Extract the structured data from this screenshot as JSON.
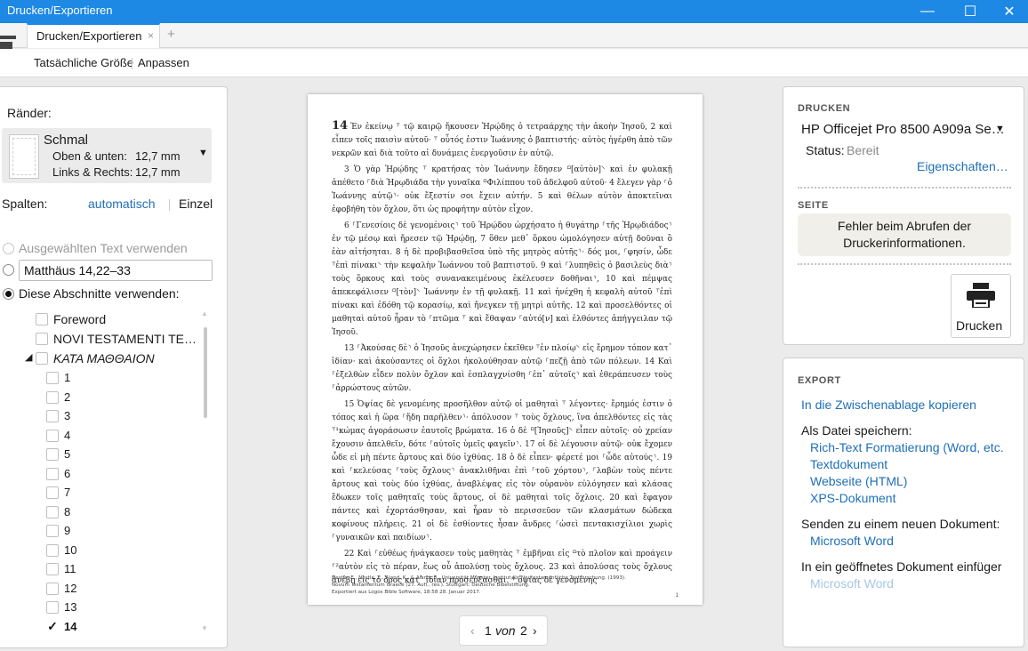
{
  "window": {
    "title": "Drucken/Exportieren",
    "minimize": "—",
    "maximize": "☐",
    "close": "✕"
  },
  "tab": {
    "label": "Drucken/Exportieren",
    "close": "×",
    "add": "+"
  },
  "toolbar": {
    "actual_size": "Tatsächliche Größe",
    "fit": "Anpassen"
  },
  "left": {
    "margins_label": "Ränder:",
    "margins": {
      "name": "Schmal",
      "top_bottom": "Oben & unten:",
      "top_bottom_value": "12,7 mm",
      "left_right": "Links & Rechts:",
      "left_right_value": "12,7 mm"
    },
    "columns_label": "Spalten:",
    "columns_auto": "automatisch",
    "columns_single": "Einzel",
    "use_selected": "Ausgewählten Text verwenden",
    "reference": "Matthäus 14,22–33",
    "use_sections": "Diese Abschnitte verwenden:",
    "tree": {
      "top_items": [
        "Foreword",
        "NOVI TESTAMENTI TE…"
      ],
      "book": "ΚΑΤΑ ΜΑΘΘΑΙΟΝ",
      "chapters": [
        "1",
        "2",
        "3",
        "4",
        "5",
        "6",
        "7",
        "8",
        "9",
        "10",
        "11",
        "12",
        "13",
        "14"
      ],
      "checked_chapter": "14"
    }
  },
  "document": {
    "chapter": "14",
    "paragraphs": [
      "Ἐν ἐκείνῳ ⸆ τῷ καιρῷ ἤκουσεν Ἡρῴδης ὁ τετραάρχης τὴν ἀκοὴν Ἰησοῦ, 2 καὶ εἶπεν τοῖς παισὶν αὐτοῦ· ⸆ οὗτός ἐστιν Ἰωάννης ὁ βαπτιστής· αὐτὸς ἠγέρθη ἀπὸ τῶν νεκρῶν καὶ διὰ τοῦτο αἱ δυνάμεις ἐνεργοῦσιν ἐν αὐτῷ.",
      "3 Ὁ γὰρ Ἡρῴδης ⸆ κρατήσας τὸν Ἰωάννην ἔδησεν ⸋[αὐτὸν]⸌ καὶ ἐν φυλακῇ ἀπέθετο ⸀διὰ Ἡρῳδιάδα τὴν γυναῖκα ⸋Φιλίππου τοῦ ἀδελφοῦ αὐτοῦ· 4 ἔλεγεν γὰρ ⸂ὁ Ἰωάννης αὐτῷ⸃· οὐκ ἔξεστίν σοι ἔχειν αὐτήν. 5 καὶ θέλων αὐτὸν ἀποκτεῖναι ἐφοβήθη τὸν ὄχλον, ὅτι ὡς προφήτην αὐτὸν εἶχον.",
      "6 ⸀Γενεσίοις δὲ γενομένοις⸃ τοῦ Ἡρῴδου ὠρχήσατο ἡ θυγάτηρ ⸀τῆς Ἡρῳδιάδος⸃ ἐν τῷ μέσῳ καὶ ἤρεσεν τῷ Ἡρῴδῃ, 7 ὅθεν μεθ᾽ ὅρκου ὡμολόγησεν αὐτῇ δοῦναι ὃ ἐὰν αἰτήσηται. 8 ἡ δὲ προβιβασθεῖσα ὑπὸ τῆς μητρὸς αὐτῆς⸃· δός μοι, ⸀φησίν, ὧδε ⸆ἐπὶ πίνακι⸌ τὴν κεφαλὴν Ἰωάννου τοῦ βαπτιστοῦ. 9 καὶ ⸀λυπηθεὶς ὁ βασιλεὺς διὰ⸃ τοὺς ὅρκους καὶ τοὺς συνανακειμένους ἐκέλευσεν δοθῆναι⸃, 10 καὶ πέμψας ἀπεκεφάλισεν ⸋[τὸν]⸌ Ἰωάννην ἐν τῇ φυλακῇ. 11 καὶ ἠνέχθη ἡ κεφαλὴ αὐτοῦ ⸆ἐπὶ πίνακι καὶ ἐδόθη τῷ κορασίῳ, καὶ ἤνεγκεν τῇ μητρὶ αὐτῆς. 12 καὶ προσελθόντες οἱ μαθηταὶ αὐτοῦ ἦραν τὸ ⸀πτῶμα ⸆ καὶ ἔθαψαν ⸀αὐτό[ν] καὶ ἐλθόντες ἀπήγγειλαν τῷ Ἰησοῦ.",
      "13 ⸀Ἀκούσας δὲ⸃ ὁ Ἰησοῦς ἀνεχώρησεν ἐκεῖθεν ⸆ἐν πλοίῳ⸌ εἰς ἔρημον τόπον κατ᾽ ἰδίαν· καὶ ἀκούσαντες οἱ ὄχλοι ἠκολούθησαν αὐτῷ ⸀πεζῇ ἀπὸ τῶν πόλεων. 14 Καὶ ⸀ἐξελθὼν εἶδεν πολὺν ὄχλον καὶ ἐσπλαγχνίσθη ⸀ἐπ᾽ αὐτοῖς⸃ καὶ ἐθεράπευσεν τοὺς ⸀ἀρρώστους αὐτῶν.",
      "15 Ὀψίας δὲ γενομένης προσῆλθον αὐτῷ οἱ μαθηταὶ ⸆ λέγοντες· ἔρημός ἐστιν ὁ τόπος καὶ ἡ ὥρα ⸀ἤδη παρῆλθεν⸃· ἀπόλυσον ⸆ τοὺς ὄχλους, ἵνα ἀπελθόντες εἰς τὰς ⸆¹κώμας ἀγοράσωσιν ἑαυτοῖς βρώματα. 16 ὁ δὲ ⸋[Ἰησοῦς]⸌ εἶπεν αὐτοῖς· οὐ χρείαν ἔχουσιν ἀπελθεῖν, δότε ⸀αὐτοῖς ὑμεῖς φαγεῖν⸃. 17 οἱ δὲ λέγουσιν αὐτῷ· οὐκ ἔχομεν ὧδε εἰ μὴ πέντε ἄρτους καὶ δύο ἰχθύας. 18 ὁ δὲ εἶπεν· φέρετέ μοι ⸀ὧδε αὐτούς⸃. 19 καὶ ⸀κελεύσας ⸀τοὺς ὄχλους⸃ ἀνακλιθῆναι ἐπὶ ⸀τοῦ χόρτου⸃, ⸀λαβὼν τοὺς πέντε ἄρτους καὶ τοὺς δύο ἰχθύας, ἀναβλέψας εἰς τὸν οὐρανὸν εὐλόγησεν καὶ κλάσας ἔδωκεν τοῖς μαθηταῖς τοὺς ἄρτους, οἱ δὲ μαθηταὶ τοῖς ὄχλοις. 20 καὶ ἔφαγον πάντες καὶ ἐχορτάσθησαν, καὶ ἦραν τὸ περισσεῦον τῶν κλασμάτων δώδεκα κοφίνους πλήρεις. 21 οἱ δὲ ἐσθίοντες ἦσαν ἄνδρες ⸀ὡσεὶ πεντακισχίλιοι χωρὶς ⸀γυναικῶν καὶ παιδίων⸃.",
      "22 Καὶ ⸀εὐθέως ἠνάγκασεν τοὺς μαθητὰς ⸆ ἐμβῆναι εἰς ⸋τὸ πλοῖον καὶ προάγειν ⸀²αὐτὸν εἰς τὸ πέραν, ἕως οὗ ἀπολύσῃ τοὺς ὄχλους. 23 καὶ ἀπολύσας τοὺς ὄχλους ἀνέβη εἰς τὸ ὄρος κατ᾽ ἰδίαν προσεύξασθαι. * ὀψίας δὲ γενομένης"
    ],
    "footer": [
      "Nestle, E., Nestle, E., Aland, K., & Aland, B., Universität Münster. Institut für Neutestamentliche Textforschung. (1993).",
      "Novum Testamentum Graece (27. Aufl., rev.). Stuttgart: Deutsche Bibelstiftung.",
      "Exportiert aus Logos Bible Software, 18:58 28. Januar 2017."
    ],
    "page_number": "1"
  },
  "pager": {
    "prev": "‹",
    "current": "1",
    "of": "von",
    "total": "2",
    "next": "›"
  },
  "print": {
    "section": "DRUCKEN",
    "printer": "HP Officejet Pro 8500 A909a Se…",
    "status_label": "Status:",
    "status_value": "Bereit",
    "properties": "Eigenschaften…",
    "page_section": "SEITE",
    "error": "Fehler beim Abrufen der Druckerinformationen.",
    "print_button": "Drucken"
  },
  "export": {
    "section": "EXPORT",
    "clipboard": "In die Zwischenablage kopieren",
    "save_as": "Als Datei speichern:",
    "formats": [
      "Rich-Text Formatierung (Word, etc.",
      "Textdokument",
      "Webseite (HTML)",
      "XPS-Dokument"
    ],
    "send_new": "Senden zu einem neuen Dokument:",
    "send_new_target": "Microsoft Word",
    "open_doc": "In ein geöffnetes Dokument einfüger",
    "open_doc_target": "Microsoft Word"
  },
  "colors": {
    "accent": "#1e88e5",
    "link": "#1e6fb8",
    "disabled_link": "#a7c7e6"
  }
}
